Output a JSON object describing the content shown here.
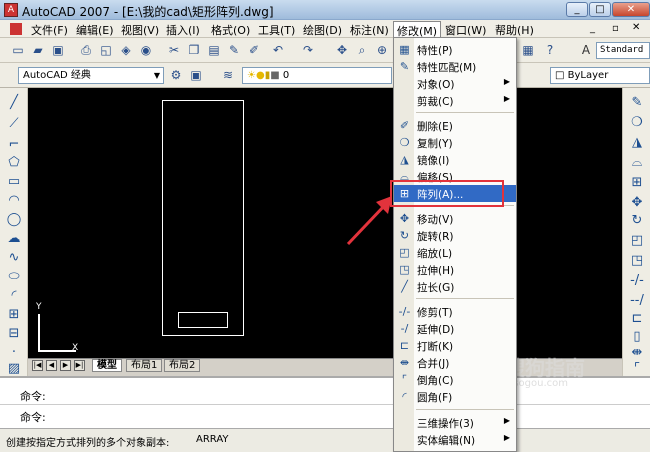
{
  "window": {
    "title": "AutoCAD 2007 - [E:\\我的cad\\矩形阵列.dwg]"
  },
  "menubar": {
    "items": [
      "文件(F)",
      "编辑(E)",
      "视图(V)",
      "插入(I)",
      "格式(O)",
      "工具(T)",
      "绘图(D)",
      "标注(N)",
      "修改(M)",
      "窗口(W)",
      "帮助(H)"
    ],
    "active": "修改(M)"
  },
  "toolbar": {
    "workspace": "AutoCAD 经典",
    "layer_value": "0",
    "text_style": "Standard",
    "color": "ByLayer"
  },
  "modify_menu": {
    "items": [
      {
        "label": "特性(P)",
        "icon": "properties-icon",
        "submenu": false
      },
      {
        "label": "特性匹配(M)",
        "icon": "match-properties-icon",
        "submenu": false
      },
      {
        "label": "对象(O)",
        "icon": "",
        "submenu": true
      },
      {
        "label": "剪裁(C)",
        "icon": "",
        "submenu": true
      },
      {
        "label": "删除(E)",
        "icon": "erase-icon",
        "submenu": false
      },
      {
        "label": "复制(Y)",
        "icon": "copy-icon",
        "submenu": false
      },
      {
        "label": "镜像(I)",
        "icon": "mirror-icon",
        "submenu": false
      },
      {
        "label": "偏移(S)",
        "icon": "offset-icon",
        "submenu": false
      },
      {
        "label": "阵列(A)...",
        "icon": "array-icon",
        "submenu": false,
        "highlighted": true
      },
      {
        "label": "移动(V)",
        "icon": "move-icon",
        "submenu": false
      },
      {
        "label": "旋转(R)",
        "icon": "rotate-icon",
        "submenu": false
      },
      {
        "label": "缩放(L)",
        "icon": "scale-icon",
        "submenu": false
      },
      {
        "label": "拉伸(H)",
        "icon": "stretch-icon",
        "submenu": false
      },
      {
        "label": "拉长(G)",
        "icon": "lengthen-icon",
        "submenu": false
      },
      {
        "label": "修剪(T)",
        "icon": "trim-icon",
        "submenu": false
      },
      {
        "label": "延伸(D)",
        "icon": "extend-icon",
        "submenu": false
      },
      {
        "label": "打断(K)",
        "icon": "break-icon",
        "submenu": false
      },
      {
        "label": "合并(J)",
        "icon": "join-icon",
        "submenu": false
      },
      {
        "label": "倒角(C)",
        "icon": "chamfer-icon",
        "submenu": false
      },
      {
        "label": "圆角(F)",
        "icon": "fillet-icon",
        "submenu": false
      },
      {
        "label": "三维操作(3)",
        "icon": "",
        "submenu": true
      },
      {
        "label": "实体编辑(N)",
        "icon": "",
        "submenu": true
      }
    ]
  },
  "layout_tabs": [
    "模型",
    "布局1",
    "布局2"
  ],
  "command": {
    "line1": "命令:",
    "line2": "命令:"
  },
  "status": {
    "prompt": "创建按指定方式排列的多个对象副本:",
    "command": "ARRAY"
  },
  "watermark": {
    "brand": "搜狗指南",
    "url": "zhinan.sogou.com"
  },
  "ucs": {
    "x": "X",
    "y": "Y"
  },
  "colors": {
    "highlight": "#316ac5",
    "annotation": "#e2333c",
    "canvas": "#000000"
  }
}
